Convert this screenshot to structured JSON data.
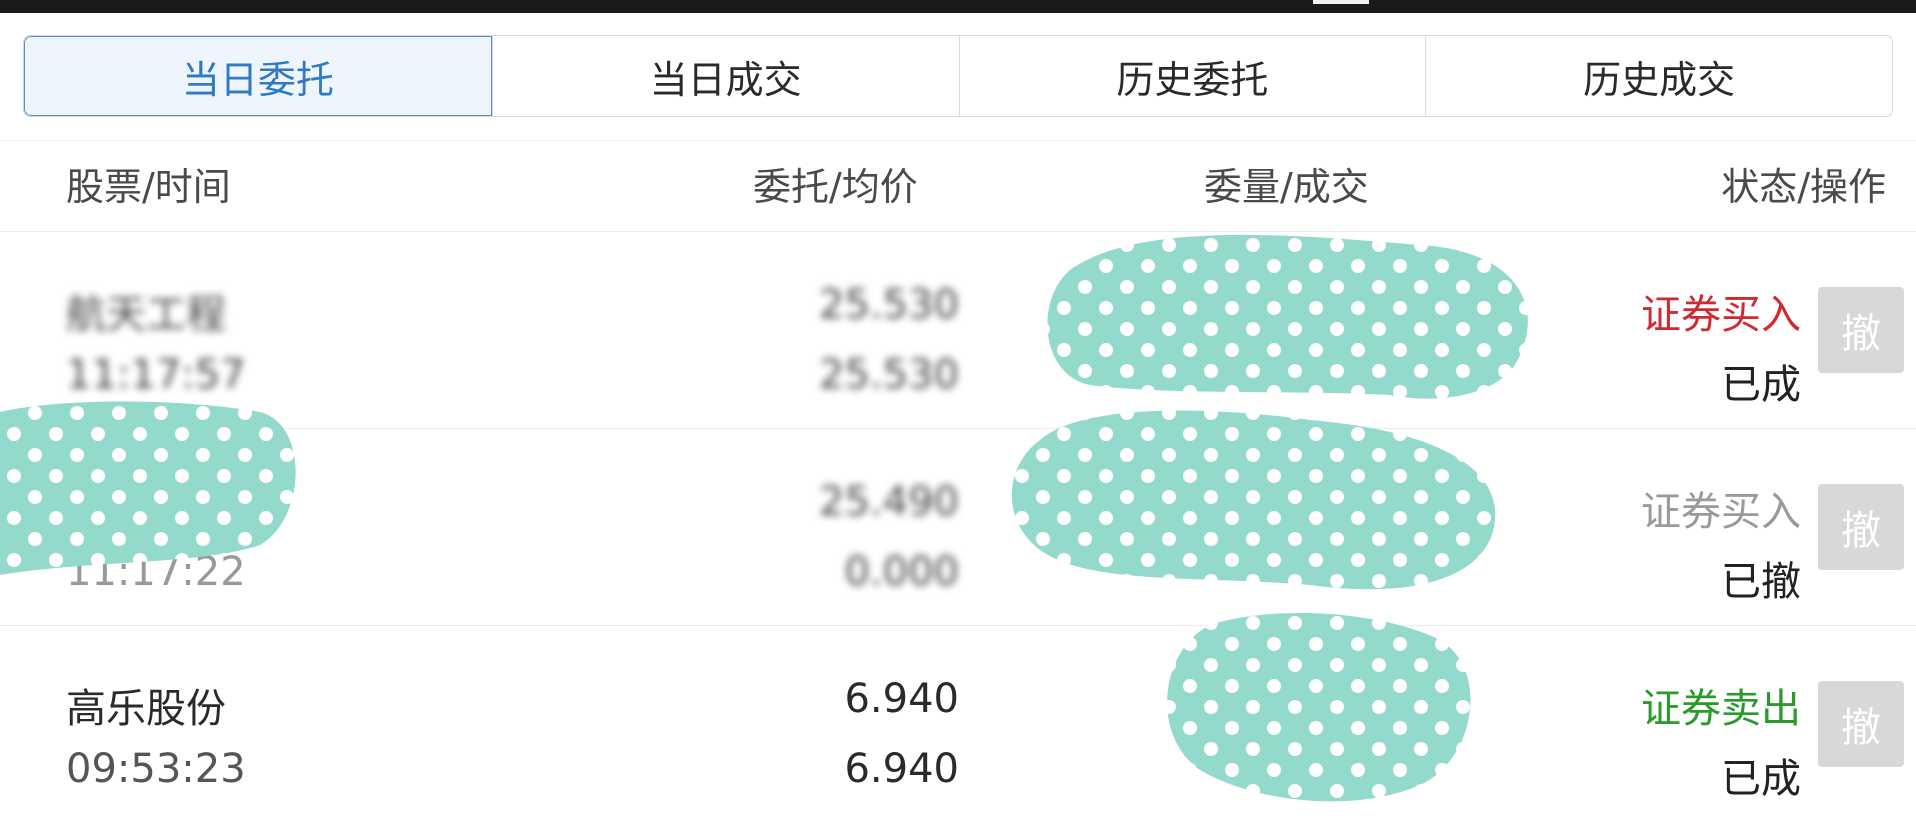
{
  "tabs": [
    {
      "label": "当日委托",
      "active": true
    },
    {
      "label": "当日成交",
      "active": false
    },
    {
      "label": "历史委托",
      "active": false
    },
    {
      "label": "历史成交",
      "active": false
    }
  ],
  "header": {
    "col1": "股票/时间",
    "col2": "委托/均价",
    "col3": "委量/成交",
    "col4": "状态/操作"
  },
  "rows": [
    {
      "name": "航天工程",
      "time": "11:17:57",
      "price": "25.530",
      "avg": "25.530",
      "qty": "",
      "deal": "",
      "direction": "证券买入",
      "status": "已成",
      "action": "撤"
    },
    {
      "name": "",
      "time": "11:17:22",
      "price": "25.490",
      "avg": "0.000",
      "qty": "",
      "deal": "",
      "direction": "证券买入",
      "status": "已撤",
      "action": "撤"
    },
    {
      "name": "高乐股份",
      "time": "09:53:23",
      "price": "6.940",
      "avg": "6.940",
      "qty": "",
      "deal": "",
      "direction": "证券卖出",
      "status": "已成",
      "action": "撤"
    }
  ],
  "colors": {
    "active_tab": "#2f7ac3",
    "buy": "#d0292f",
    "sell": "#2a9a2a",
    "cancelled": "#9a9a9a",
    "redaction": "#93d9cc"
  }
}
